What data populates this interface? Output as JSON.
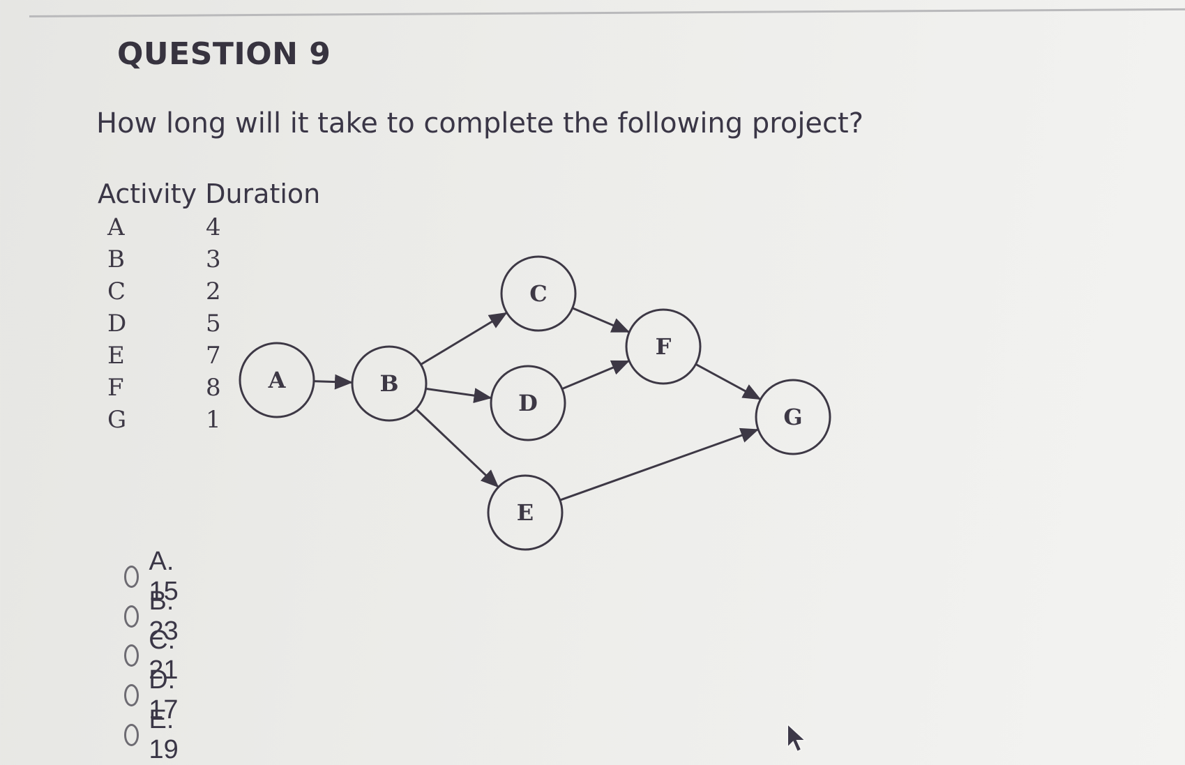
{
  "question": {
    "title": "QUESTION 9",
    "text": "How long will it take to complete the following project?"
  },
  "activity_table": {
    "headers": [
      "Activity",
      "Duration"
    ],
    "header_text": "Activity Duration",
    "rows": [
      {
        "activity": "A",
        "duration": "4"
      },
      {
        "activity": "B",
        "duration": "3"
      },
      {
        "activity": "C",
        "duration": "2"
      },
      {
        "activity": "D",
        "duration": "5"
      },
      {
        "activity": "E",
        "duration": "7"
      },
      {
        "activity": "F",
        "duration": "8"
      },
      {
        "activity": "G",
        "duration": "1"
      }
    ]
  },
  "network": {
    "nodes": [
      "A",
      "B",
      "C",
      "D",
      "E",
      "F",
      "G"
    ],
    "edges": [
      {
        "from": "A",
        "to": "B"
      },
      {
        "from": "B",
        "to": "C"
      },
      {
        "from": "B",
        "to": "D"
      },
      {
        "from": "B",
        "to": "E"
      },
      {
        "from": "C",
        "to": "F"
      },
      {
        "from": "D",
        "to": "F"
      },
      {
        "from": "F",
        "to": "G"
      },
      {
        "from": "E",
        "to": "G"
      }
    ]
  },
  "options": [
    {
      "label": "A. 15",
      "selected": false
    },
    {
      "label": "B. 23",
      "selected": false
    },
    {
      "label": "C. 21",
      "selected": false
    },
    {
      "label": "D. 17",
      "selected": false
    },
    {
      "label": "E. 19",
      "selected": false
    }
  ],
  "colors": {
    "text": "#3a3646",
    "line": "#3d3845",
    "background": "#ecece9"
  },
  "icons": {
    "cursor": "mouse-pointer-arrow-icon",
    "radio": "radio-unselected-icon"
  }
}
